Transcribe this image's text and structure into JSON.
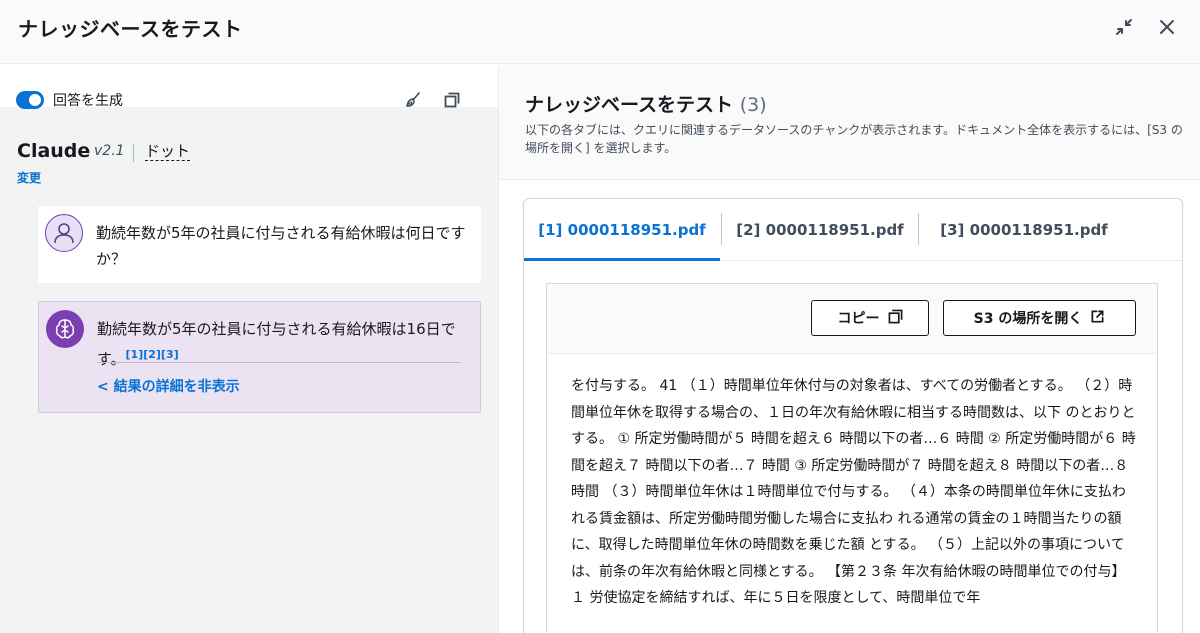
{
  "header": {
    "title": "ナレッジベースをテスト"
  },
  "left": {
    "toggle_label": "回答を生成",
    "model": {
      "name": "Claude",
      "version": "v2.1",
      "variant": "ドット",
      "change_label": "変更"
    },
    "user_message": "勤続年数が5年の社員に付与される有給休暇は何日ですか？",
    "bot_message": "勤続年数が5年の社員に付与される有給休暇は16日です。",
    "citations": "[1][2][3]",
    "hide_details_label": "< 結果の詳細を非表示"
  },
  "right": {
    "title": "ナレッジベースをテスト",
    "count": "(3)",
    "description": "以下の各タブには、クエリに関連するデータソースのチャンクが表示されます。ドキュメント全体を表示するには、[S3 の場所を開く] を選択します。",
    "tabs": [
      {
        "label": "[1] 0000118951.pdf",
        "active": true
      },
      {
        "label": "[2] 0000118951.pdf",
        "active": false
      },
      {
        "label": "[3] 0000118951.pdf",
        "active": false
      }
    ],
    "copy_label": "コピー",
    "open_s3_label": "S3 の場所を開く",
    "content": "を付与する。 41 （１）時間単位年休付与の対象者は、すべての労働者とする。 （２）時間単位年休を取得する場合の、１日の年次有給休暇に相当する時間数は、以下 のとおりとする。 ① 所定労働時間が５ 時間を超え６ 時間以下の者…６ 時間 ② 所定労働時間が６ 時間を超え７ 時間以下の者…７ 時間 ③ 所定労働時間が７ 時間を超え８ 時間以下の者…８ 時間 （３）時間単位年休は１時間単位で付与する。 （４）本条の時間単位年休に支払われる賃金額は、所定労働時間労働した場合に支払わ れる通常の賃金の１時間当たりの額に、取得した時間単位年休の時間数を乗じた額 とする。 （５）上記以外の事項については、前条の年次有給休暇と同様とする。 【第２３条 年次有給休暇の時間単位での付与】 １ 労使協定を締結すれば、年に５日を限度として、時間単位で年"
  },
  "colors": {
    "accent": "#0972d3",
    "bot_avatar": "#7b3fb1",
    "bot_bubble": "#ece3f2"
  }
}
